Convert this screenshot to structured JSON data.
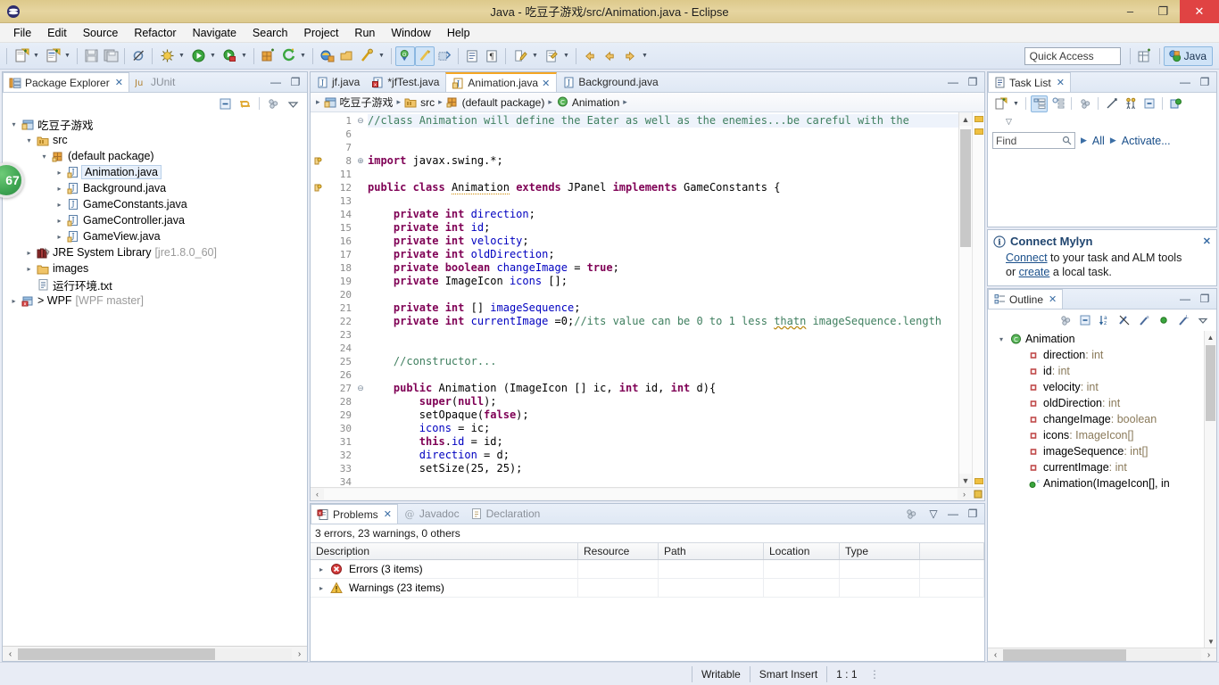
{
  "window": {
    "title": "Java - 吃豆子游戏/src/Animation.java - Eclipse",
    "minimize": "–",
    "maximize": "❐",
    "close": "✕"
  },
  "menubar": {
    "items": [
      "File",
      "Edit",
      "Source",
      "Refactor",
      "Navigate",
      "Search",
      "Project",
      "Run",
      "Window",
      "Help"
    ]
  },
  "toolbar": {
    "quick_access_placeholder": "Quick Access",
    "perspective_label": "Java",
    "icons": [
      "new-wizard-icon",
      "new-java-class-icon",
      "save-icon",
      "save-all-icon",
      "skip-breakpoints-icon",
      "debug-icon",
      "run-icon",
      "run-coverage-icon",
      "new-java-package-icon",
      "external-tools-icon",
      "open-type-icon",
      "open-task-icon",
      "toggle-mark-occurrences-icon",
      "toggle-editor-breadcrumb-icon",
      "restore-last-selection-icon",
      "next-annotation-icon",
      "previous-annotation-icon",
      "back-icon",
      "forward-icon"
    ]
  },
  "package_explorer": {
    "tabs": [
      {
        "label": "Package Explorer",
        "active": true,
        "icon": "package-explorer-icon",
        "close": "✕"
      },
      {
        "label": "JUnit",
        "active": false,
        "icon": "junit-icon",
        "close": ""
      }
    ],
    "view_toolbar": [
      "collapse-all-icon",
      "link-with-editor-icon",
      "view-menu-icon",
      "view-dropdown-icon"
    ],
    "minimize": "—",
    "maximize": "❐",
    "tree": [
      {
        "depth": 0,
        "twist": "▾",
        "icon": "java-project-icon",
        "label": "吃豆子游戏",
        "suffix": "",
        "selected": false
      },
      {
        "depth": 1,
        "twist": "▾",
        "icon": "source-folder-icon",
        "label": "src",
        "suffix": "",
        "selected": false
      },
      {
        "depth": 2,
        "twist": "▾",
        "icon": "package-icon",
        "label": "(default package)",
        "suffix": "",
        "selected": false
      },
      {
        "depth": 3,
        "twist": "▸",
        "icon": "java-file-icon",
        "label": "Animation.java",
        "suffix": "",
        "selected": true
      },
      {
        "depth": 3,
        "twist": "▸",
        "icon": "java-file-icon",
        "label": "Background.java",
        "suffix": "",
        "selected": false
      },
      {
        "depth": 3,
        "twist": "▸",
        "icon": "java-file-plain-icon",
        "label": "GameConstants.java",
        "suffix": "",
        "selected": false
      },
      {
        "depth": 3,
        "twist": "▸",
        "icon": "java-file-icon",
        "label": "GameController.java",
        "suffix": "",
        "selected": false
      },
      {
        "depth": 3,
        "twist": "▸",
        "icon": "java-file-icon",
        "label": "GameView.java",
        "suffix": "",
        "selected": false
      },
      {
        "depth": 1,
        "twist": "▸",
        "icon": "library-icon",
        "label": "JRE System Library",
        "suffix": "[jre1.8.0_60]",
        "selected": false
      },
      {
        "depth": 1,
        "twist": "▸",
        "icon": "folder-icon",
        "label": "images",
        "suffix": "",
        "selected": false
      },
      {
        "depth": 1,
        "twist": "",
        "icon": "text-file-icon",
        "label": "运行环境.txt",
        "suffix": "",
        "selected": false
      },
      {
        "depth": 0,
        "twist": "▸",
        "icon": "git-project-icon",
        "label": "> WPF",
        "suffix": "[WPF master]",
        "selected": false
      }
    ],
    "badge": "67"
  },
  "editor": {
    "tabs": [
      {
        "label": "jf.java",
        "active": false,
        "dirty": false,
        "error": false,
        "close": ""
      },
      {
        "label": "*jfTest.java",
        "active": false,
        "dirty": true,
        "error": true,
        "close": ""
      },
      {
        "label": "Animation.java",
        "active": true,
        "dirty": false,
        "error": false,
        "close": "✕"
      },
      {
        "label": "Background.java",
        "active": false,
        "dirty": false,
        "error": false,
        "close": ""
      }
    ],
    "minimize": "—",
    "maximize": "❐",
    "breadcrumb": [
      {
        "icon": "java-project-icon",
        "label": "吃豆子游戏"
      },
      {
        "icon": "source-folder-icon",
        "label": "src"
      },
      {
        "icon": "package-icon",
        "label": "(default package)"
      },
      {
        "icon": "class-icon",
        "label": "Animation"
      }
    ],
    "lines": [
      {
        "num": "1",
        "fold": "⊖",
        "marker": "",
        "highlight": true,
        "tokens": [
          {
            "t": "//class Animation will define the Eater as well as the enemies...be careful with the ",
            "c": "cmt"
          }
        ]
      },
      {
        "num": "6",
        "fold": "",
        "marker": "",
        "highlight": false,
        "tokens": []
      },
      {
        "num": "7",
        "fold": "",
        "marker": "",
        "highlight": false,
        "tokens": []
      },
      {
        "num": "8",
        "fold": "⊕",
        "marker": "warning",
        "highlight": false,
        "tokens": [
          {
            "t": "import",
            "c": "kw"
          },
          {
            "t": " javax.swing.*;",
            "c": ""
          }
        ]
      },
      {
        "num": "11",
        "fold": "",
        "marker": "",
        "highlight": false,
        "tokens": []
      },
      {
        "num": "12",
        "fold": "",
        "marker": "warning",
        "highlight": false,
        "tokens": [
          {
            "t": "public ",
            "c": "kw"
          },
          {
            "t": "class ",
            "c": "kw"
          },
          {
            "t": "Animation",
            "c": "und"
          },
          {
            "t": " ",
            "c": ""
          },
          {
            "t": "extends",
            "c": "kw"
          },
          {
            "t": " JPanel ",
            "c": ""
          },
          {
            "t": "implements",
            "c": "kw"
          },
          {
            "t": " GameConstants {",
            "c": ""
          }
        ]
      },
      {
        "num": "13",
        "fold": "",
        "marker": "",
        "highlight": false,
        "tokens": []
      },
      {
        "num": "14",
        "fold": "",
        "marker": "",
        "highlight": false,
        "tokens": [
          {
            "t": "    ",
            "c": ""
          },
          {
            "t": "private ",
            "c": "kw"
          },
          {
            "t": "int ",
            "c": "kw"
          },
          {
            "t": "direction",
            "c": "fld"
          },
          {
            "t": ";",
            "c": ""
          }
        ]
      },
      {
        "num": "15",
        "fold": "",
        "marker": "",
        "highlight": false,
        "tokens": [
          {
            "t": "    ",
            "c": ""
          },
          {
            "t": "private ",
            "c": "kw"
          },
          {
            "t": "int ",
            "c": "kw"
          },
          {
            "t": "id",
            "c": "fld"
          },
          {
            "t": ";",
            "c": ""
          }
        ]
      },
      {
        "num": "16",
        "fold": "",
        "marker": "",
        "highlight": false,
        "tokens": [
          {
            "t": "    ",
            "c": ""
          },
          {
            "t": "private ",
            "c": "kw"
          },
          {
            "t": "int ",
            "c": "kw"
          },
          {
            "t": "velocity",
            "c": "fld"
          },
          {
            "t": ";",
            "c": ""
          }
        ]
      },
      {
        "num": "17",
        "fold": "",
        "marker": "",
        "highlight": false,
        "tokens": [
          {
            "t": "    ",
            "c": ""
          },
          {
            "t": "private ",
            "c": "kw"
          },
          {
            "t": "int ",
            "c": "kw"
          },
          {
            "t": "oldDirection",
            "c": "fld"
          },
          {
            "t": ";",
            "c": ""
          }
        ]
      },
      {
        "num": "18",
        "fold": "",
        "marker": "",
        "highlight": false,
        "tokens": [
          {
            "t": "    ",
            "c": ""
          },
          {
            "t": "private ",
            "c": "kw"
          },
          {
            "t": "boolean ",
            "c": "kw"
          },
          {
            "t": "changeImage",
            "c": "fld"
          },
          {
            "t": " = ",
            "c": ""
          },
          {
            "t": "true",
            "c": "kw"
          },
          {
            "t": ";",
            "c": ""
          }
        ]
      },
      {
        "num": "19",
        "fold": "",
        "marker": "",
        "highlight": false,
        "tokens": [
          {
            "t": "    ",
            "c": ""
          },
          {
            "t": "private ",
            "c": "kw"
          },
          {
            "t": "ImageIcon ",
            "c": ""
          },
          {
            "t": "icons",
            "c": "fld"
          },
          {
            "t": " [];",
            "c": ""
          }
        ]
      },
      {
        "num": "20",
        "fold": "",
        "marker": "",
        "highlight": false,
        "tokens": []
      },
      {
        "num": "21",
        "fold": "",
        "marker": "",
        "highlight": false,
        "tokens": [
          {
            "t": "    ",
            "c": ""
          },
          {
            "t": "private ",
            "c": "kw"
          },
          {
            "t": "int ",
            "c": "kw"
          },
          {
            "t": "[] ",
            "c": ""
          },
          {
            "t": "imageSequence",
            "c": "fld"
          },
          {
            "t": ";",
            "c": ""
          }
        ]
      },
      {
        "num": "22",
        "fold": "",
        "marker": "",
        "highlight": false,
        "tokens": [
          {
            "t": "    ",
            "c": ""
          },
          {
            "t": "private ",
            "c": "kw"
          },
          {
            "t": "int ",
            "c": "kw"
          },
          {
            "t": "currentImage",
            "c": "fld"
          },
          {
            "t": " =0;",
            "c": ""
          },
          {
            "t": "//its value can be 0 to 1 less ",
            "c": "cmt"
          },
          {
            "t": "thatn",
            "c": "cmt sq"
          },
          {
            "t": " imageSequence.length",
            "c": "cmt"
          }
        ]
      },
      {
        "num": "23",
        "fold": "",
        "marker": "",
        "highlight": false,
        "tokens": []
      },
      {
        "num": "24",
        "fold": "",
        "marker": "",
        "highlight": false,
        "tokens": []
      },
      {
        "num": "25",
        "fold": "",
        "marker": "",
        "highlight": false,
        "tokens": [
          {
            "t": "    ",
            "c": ""
          },
          {
            "t": "//constructor...",
            "c": "cmt"
          }
        ]
      },
      {
        "num": "26",
        "fold": "",
        "marker": "",
        "highlight": false,
        "tokens": []
      },
      {
        "num": "27",
        "fold": "⊖",
        "marker": "",
        "highlight": false,
        "tokens": [
          {
            "t": "    ",
            "c": ""
          },
          {
            "t": "public ",
            "c": "kw"
          },
          {
            "t": "Animation (ImageIcon [] ic, ",
            "c": ""
          },
          {
            "t": "int ",
            "c": "kw"
          },
          {
            "t": "id, ",
            "c": ""
          },
          {
            "t": "int ",
            "c": "kw"
          },
          {
            "t": "d){",
            "c": ""
          }
        ]
      },
      {
        "num": "28",
        "fold": "",
        "marker": "",
        "highlight": false,
        "tokens": [
          {
            "t": "        ",
            "c": ""
          },
          {
            "t": "super",
            "c": "kw"
          },
          {
            "t": "(",
            "c": ""
          },
          {
            "t": "null",
            "c": "kw"
          },
          {
            "t": ");",
            "c": ""
          }
        ]
      },
      {
        "num": "29",
        "fold": "",
        "marker": "",
        "highlight": false,
        "tokens": [
          {
            "t": "        setOpaque(",
            "c": ""
          },
          {
            "t": "false",
            "c": "kw"
          },
          {
            "t": ");",
            "c": ""
          }
        ]
      },
      {
        "num": "30",
        "fold": "",
        "marker": "",
        "highlight": false,
        "tokens": [
          {
            "t": "        ",
            "c": ""
          },
          {
            "t": "icons",
            "c": "fld"
          },
          {
            "t": " = ic;",
            "c": ""
          }
        ]
      },
      {
        "num": "31",
        "fold": "",
        "marker": "",
        "highlight": false,
        "tokens": [
          {
            "t": "        ",
            "c": ""
          },
          {
            "t": "this",
            "c": "kw"
          },
          {
            "t": ".",
            "c": ""
          },
          {
            "t": "id",
            "c": "fld"
          },
          {
            "t": " = id;",
            "c": ""
          }
        ]
      },
      {
        "num": "32",
        "fold": "",
        "marker": "",
        "highlight": false,
        "tokens": [
          {
            "t": "        ",
            "c": ""
          },
          {
            "t": "direction",
            "c": "fld"
          },
          {
            "t": " = d;",
            "c": ""
          }
        ]
      },
      {
        "num": "33",
        "fold": "",
        "marker": "",
        "highlight": false,
        "tokens": [
          {
            "t": "        setSize(25, 25);",
            "c": ""
          }
        ]
      },
      {
        "num": "34",
        "fold": "",
        "marker": "",
        "highlight": false,
        "tokens": []
      }
    ]
  },
  "problems": {
    "tabs": [
      {
        "label": "Problems",
        "active": true,
        "icon": "problems-icon",
        "close": "✕"
      },
      {
        "label": "Javadoc",
        "active": false,
        "icon": "javadoc-icon",
        "close": ""
      },
      {
        "label": "Declaration",
        "active": false,
        "icon": "declaration-icon",
        "close": ""
      }
    ],
    "summary": "3 errors, 23 warnings, 0 others",
    "columns": [
      "Description",
      "Resource",
      "Path",
      "Location",
      "Type"
    ],
    "rows": [
      {
        "twist": "▸",
        "icon": "error-icon",
        "description": "Errors (3 items)",
        "resource": "",
        "path": "",
        "location": "",
        "type": ""
      },
      {
        "twist": "▸",
        "icon": "warning-icon",
        "description": "Warnings (23 items)",
        "resource": "",
        "path": "",
        "location": "",
        "type": ""
      }
    ],
    "view_toolbar": [
      "view-menu-icon",
      "view-dropdown-icon"
    ],
    "minimize": "—",
    "maximize": "❐"
  },
  "task_list": {
    "tabs": [
      {
        "label": "Task List",
        "active": true,
        "icon": "task-list-icon",
        "close": "✕"
      }
    ],
    "minimize": "—",
    "maximize": "❐",
    "find_placeholder": "Find",
    "find_value": "Find",
    "all_label": "All",
    "activate_label": "Activate...",
    "toolbar": [
      "new-task-icon",
      "categorize-icon",
      "schedule-icon",
      "synchronize-icon",
      "focus-icon",
      "collapse-all-icon",
      "task-presentation-icon",
      "view-menu-icon"
    ]
  },
  "mylyn": {
    "title": "Connect Mylyn",
    "close": "✕",
    "line1_link": "Connect",
    "line1_text": " to your task and ALM tools",
    "line2_pre": "or ",
    "line2_link": "create",
    "line2_post": " a local task."
  },
  "outline": {
    "tabs": [
      {
        "label": "Outline",
        "active": true,
        "icon": "outline-icon",
        "close": "✕"
      }
    ],
    "minimize": "—",
    "maximize": "❐",
    "toolbar": [
      "focus-icon",
      "collapse-all-icon",
      "sort-icon",
      "hide-fields-icon",
      "hide-static-icon",
      "hide-nonpublic-icon",
      "hide-local-types-icon",
      "view-menu-icon"
    ],
    "items": [
      {
        "depth": 0,
        "twist": "▾",
        "icon": "class-icon",
        "label": "Animation",
        "type": ""
      },
      {
        "depth": 1,
        "twist": "",
        "icon": "private-field-icon",
        "label": "direction",
        "type": " : int"
      },
      {
        "depth": 1,
        "twist": "",
        "icon": "private-field-icon",
        "label": "id",
        "type": " : int"
      },
      {
        "depth": 1,
        "twist": "",
        "icon": "private-field-icon",
        "label": "velocity",
        "type": " : int"
      },
      {
        "depth": 1,
        "twist": "",
        "icon": "private-field-icon",
        "label": "oldDirection",
        "type": " : int"
      },
      {
        "depth": 1,
        "twist": "",
        "icon": "private-field-icon",
        "label": "changeImage",
        "type": " : boolean"
      },
      {
        "depth": 1,
        "twist": "",
        "icon": "private-field-icon",
        "label": "icons",
        "type": " : ImageIcon[]"
      },
      {
        "depth": 1,
        "twist": "",
        "icon": "private-field-icon",
        "label": "imageSequence",
        "type": " : int[]"
      },
      {
        "depth": 1,
        "twist": "",
        "icon": "private-field-icon",
        "label": "currentImage",
        "type": " : int"
      },
      {
        "depth": 1,
        "twist": "",
        "icon": "public-constructor-icon",
        "label": "Animation(ImageIcon[], in",
        "type": ""
      }
    ]
  },
  "statusbar": {
    "writable": "Writable",
    "insert_mode": "Smart Insert",
    "position": "1 : 1"
  }
}
